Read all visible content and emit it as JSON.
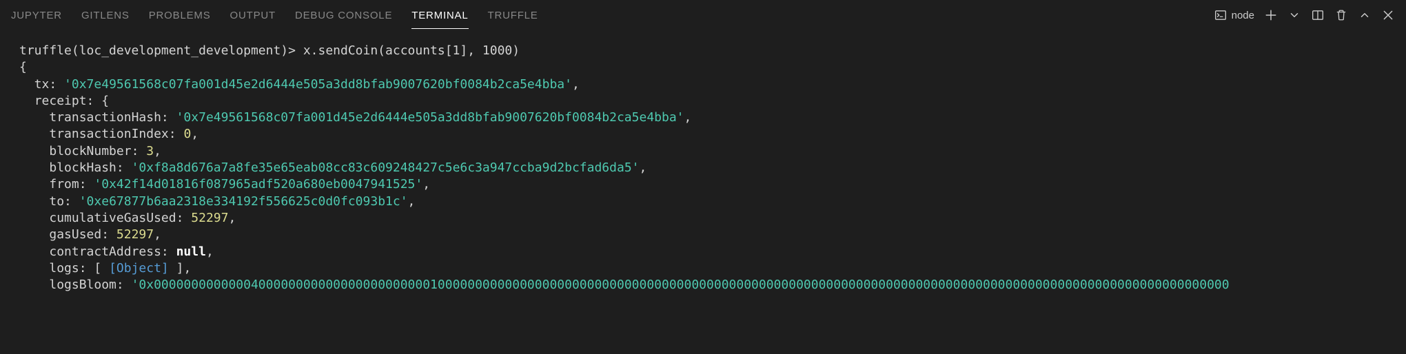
{
  "tabs": {
    "jupyter": "JUPYTER",
    "gitlens": "GITLENS",
    "problems": "PROBLEMS",
    "output": "OUTPUT",
    "debug_console": "DEBUG CONSOLE",
    "terminal": "TERMINAL",
    "truffle": "TRUFFLE"
  },
  "header": {
    "shell_name": "node"
  },
  "terminal": {
    "prompt": "truffle(loc_development_development)>",
    "command": "x.sendCoin(accounts[1], 1000)",
    "open_brace": "{",
    "tx_key": "tx:",
    "tx_value": "'0x7e49561568c07fa001d45e2d6444e505a3dd8bfab9007620bf0084b2ca5e4bba'",
    "receipt_key": "receipt: {",
    "th_key": "transactionHash:",
    "th_value": "'0x7e49561568c07fa001d45e2d6444e505a3dd8bfab9007620bf0084b2ca5e4bba'",
    "ti_key": "transactionIndex:",
    "ti_value": "0",
    "bn_key": "blockNumber:",
    "bn_value": "3",
    "bh_key": "blockHash:",
    "bh_value": "'0xf8a8d676a7a8fe35e65eab08cc83c609248427c5e6c3a947ccba9d2bcfad6da5'",
    "from_key": "from:",
    "from_value": "'0x42f14d01816f087965adf520a680eb0047941525'",
    "to_key": "to:",
    "to_value": "'0xe67877b6aa2318e334192f556625c0d0fc093b1c'",
    "cgu_key": "cumulativeGasUsed:",
    "cgu_value": "52297",
    "gu_key": "gasUsed:",
    "gu_value": "52297",
    "ca_key": "contractAddress:",
    "ca_value": "null",
    "logs_key": "logs:",
    "logs_open": "[",
    "logs_obj": "[Object]",
    "logs_close": "]",
    "lb_key": "logsBloom:",
    "lb_value": "'0x000000000000040000000000000000000000010000000000000000000000000000000000000000000000000000000000000000000000000000000000000000000000000000000000"
  }
}
